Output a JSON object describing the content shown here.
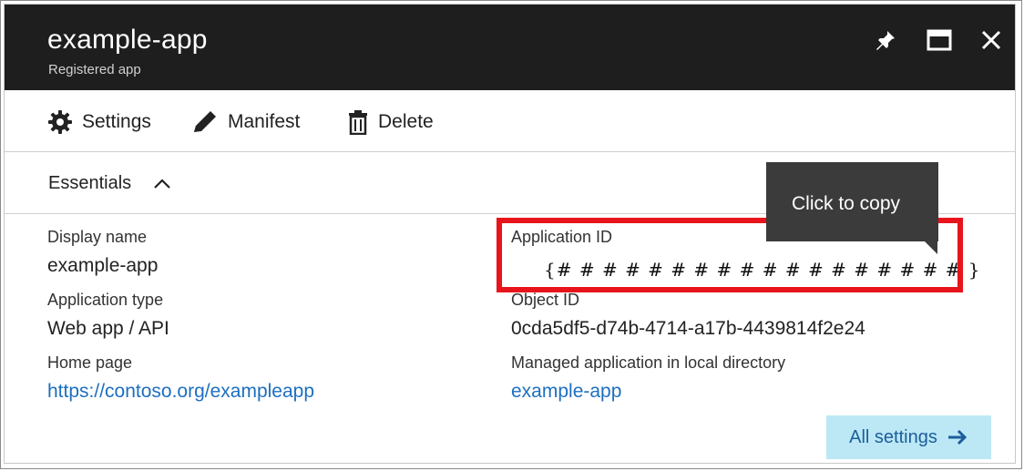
{
  "header": {
    "title": "example-app",
    "subtitle": "Registered app",
    "icons": [
      "pin-icon",
      "maximize-icon",
      "close-icon"
    ]
  },
  "toolbar": {
    "settings_label": "Settings",
    "manifest_label": "Manifest",
    "delete_label": "Delete"
  },
  "essentials": {
    "label": "Essentials",
    "left": [
      {
        "label": "Display name",
        "value": "example-app",
        "is_link": false
      },
      {
        "label": "Application type",
        "value": "Web app / API",
        "is_link": false
      },
      {
        "label": "Home page",
        "value": "https://contoso.org/exampleapp",
        "is_link": true
      }
    ],
    "right": [
      {
        "label": "Application ID",
        "value": "{# # # # # # # # # # # # # # # # # # }",
        "is_link": false
      },
      {
        "label": "Object ID",
        "value": "0cda5df5-d74b-4714-a17b-4439814f2e24",
        "is_link": false
      },
      {
        "label": "Managed application in local directory",
        "value": "example-app",
        "is_link": true
      }
    ]
  },
  "tooltip": {
    "text": "Click to copy"
  },
  "all_settings": {
    "label": "All settings"
  },
  "colors": {
    "header_bg": "#1e1e1e",
    "link": "#1d6fc0",
    "highlight": "#e8141c",
    "tooltip_bg": "#3b3b3b",
    "button_bg": "#bce8f6"
  }
}
